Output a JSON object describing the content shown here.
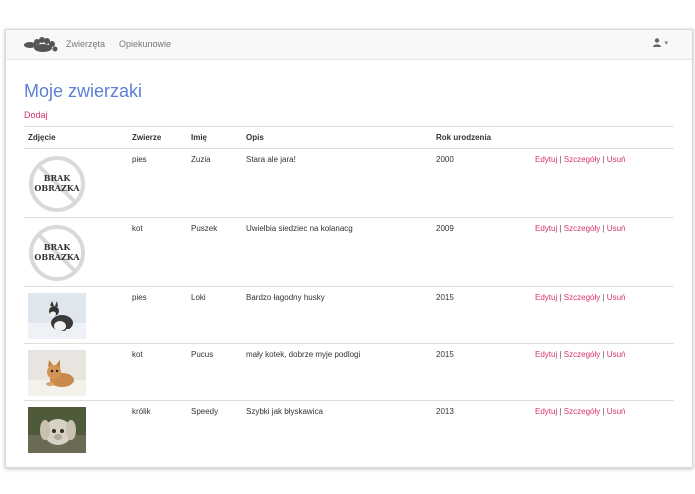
{
  "nav": {
    "links": [
      "Zwierzęta",
      "Opiekunowie"
    ],
    "user_caret": "▾"
  },
  "page": {
    "title": "Moje zwierzaki",
    "add_label": "Dodaj"
  },
  "table": {
    "headers": [
      "Zdjęcie",
      "Zwierze",
      "Imię",
      "Opis",
      "Rok urodzenia",
      ""
    ],
    "no_image_text": [
      "BRAK",
      "OBRAZKA"
    ],
    "actions": [
      "Edytuj",
      "Szczegóły",
      "Usuń"
    ],
    "action_separator": "|",
    "rows": [
      {
        "image": "no-image",
        "animal": "pies",
        "name": "Zuzia",
        "desc": "Stara ale jara!",
        "year": "2000"
      },
      {
        "image": "no-image",
        "animal": "kot",
        "name": "Puszek",
        "desc": "Uwielbia siedziec na kolanacg",
        "year": "2009"
      },
      {
        "image": "husky-photo",
        "animal": "pies",
        "name": "Loki",
        "desc": "Bardzo łagodny husky",
        "year": "2015"
      },
      {
        "image": "kitten-photo",
        "animal": "kot",
        "name": "Pucus",
        "desc": "mały kotek, dobrze myje podlogi",
        "year": "2015"
      },
      {
        "image": "rabbit-photo",
        "animal": "królik",
        "name": "Speedy",
        "desc": "Szybki jak błyskawica",
        "year": "2013"
      }
    ]
  },
  "colors": {
    "title": "#5b7fd6",
    "link": "#d9346a",
    "navbar_bg": "#f8f8f8"
  }
}
